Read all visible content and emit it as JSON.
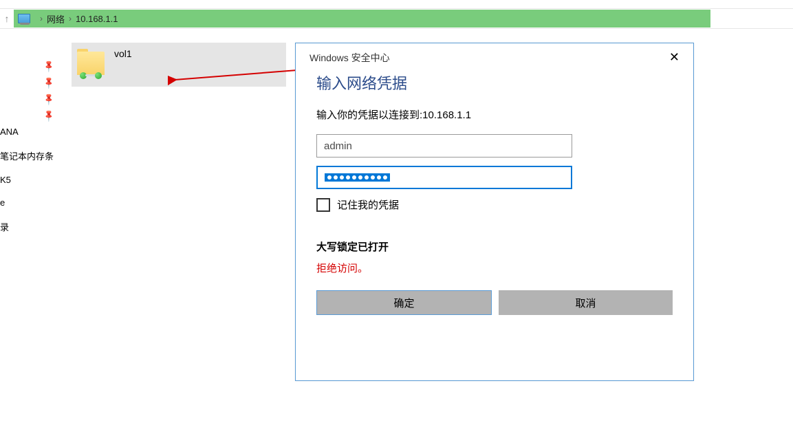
{
  "breadcrumb": {
    "seg1": "网络",
    "seg2": "10.168.1.1"
  },
  "sidebar": {
    "items": [
      "ANA",
      "笔记本内存条",
      "K5",
      "e",
      "录"
    ]
  },
  "folder": {
    "label": "vol1"
  },
  "dialog": {
    "header": "Windows 安全中心",
    "title": "输入网络凭据",
    "subtitle": "输入你的凭据以连接到:10.168.1.1",
    "username": "admin",
    "password_len": 10,
    "remember": "记住我的凭据",
    "caps_warning": "大写锁定已打开",
    "error": "拒绝访问。",
    "ok": "确定",
    "cancel": "取消"
  }
}
